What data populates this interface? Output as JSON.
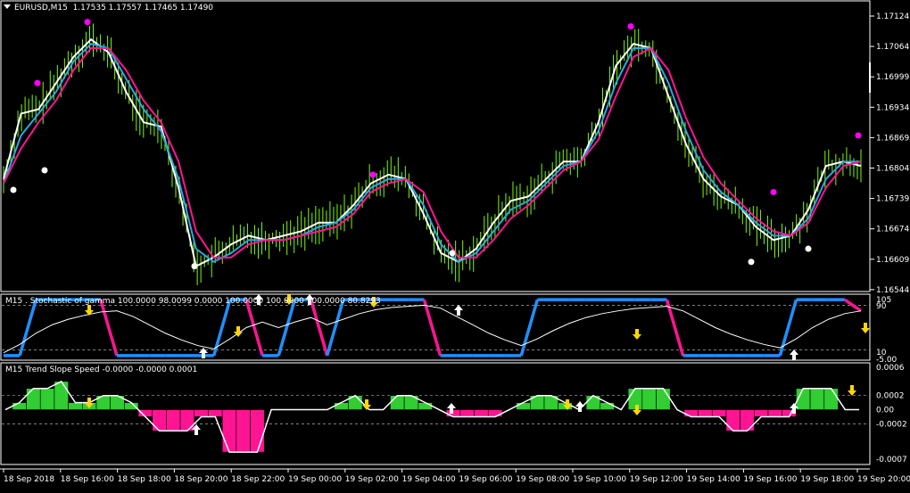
{
  "main_window": {
    "title": "EURUSD,M15",
    "ohlc": "1.17535 1.17557 1.17465 1.17490",
    "price_axis": [
      "1.17124",
      "1.17064",
      "1.16999",
      "1.16934",
      "1.16869",
      "1.16804",
      "1.16739",
      "1.16674",
      "1.16609",
      "1.16544"
    ]
  },
  "stoch_window": {
    "title": "M15 . Stochastic of gamma 100.0000 98.0099 0.0000 100.0000 100.0000 100.0000 80.8293",
    "axis": [
      "105",
      "90",
      "10",
      "-5.00"
    ]
  },
  "slope_window": {
    "title": "M15 Trend Slope Speed -0.0000 -0.0000 0.0001",
    "axis": [
      "0.0006",
      "0.0002",
      "0.00",
      "-0.0002",
      "-0.0007"
    ]
  },
  "time_axis": [
    "18 Sep 2018",
    "18 Sep 16:00",
    "18 Sep 18:00",
    "18 Sep 20:00",
    "18 Sep 22:00",
    "19 Sep 00:00",
    "19 Sep 02:00",
    "19 Sep 04:00",
    "19 Sep 06:00",
    "19 Sep 08:00",
    "19 Sep 10:00",
    "19 Sep 12:00",
    "19 Sep 14:00",
    "19 Sep 16:00",
    "19 Sep 18:00",
    "19 Sep 20:00"
  ],
  "colors": {
    "bars": "#7cfc00",
    "white_line": "#ffffff",
    "blue_line": "#29a8e0",
    "pink_line": "#ff1493",
    "dot_magenta": "#ff00ff",
    "dot_white": "#ffffff",
    "stoch_blue": "#1e90ff",
    "stoch_pink": "#ff1493",
    "hist_green": "#32cd32",
    "hist_pink": "#ff1493",
    "arrow_white": "#ffffff",
    "arrow_yellow": "#ffd700"
  },
  "chart_data": [
    {
      "type": "line",
      "title": "EURUSD,M15",
      "ylim": [
        1.16544,
        1.1719
      ],
      "series": [
        {
          "values": [
            1.168,
            1.1695,
            1.1696,
            1.1702,
            1.1708,
            1.1712,
            1.1709,
            1.17,
            1.1693,
            1.1692,
            1.1678,
            1.166,
            1.1662,
            1.1665,
            1.1667,
            1.1666,
            1.1667,
            1.1668,
            1.167,
            1.167,
            1.1674,
            1.1679,
            1.1681,
            1.168,
            1.1672,
            1.1663,
            1.1661,
            1.1664,
            1.167,
            1.1675,
            1.1676,
            1.168,
            1.1684,
            1.1684,
            1.1693,
            1.1706,
            1.1711,
            1.171,
            1.1699,
            1.1688,
            1.168,
            1.1676,
            1.1674,
            1.1669,
            1.1666,
            1.1667,
            1.1673,
            1.1683,
            1.1684,
            1.1683
          ]
        },
        {
          "values": [
            1.1679,
            1.169,
            1.1695,
            1.17,
            1.1707,
            1.1711,
            1.171,
            1.1703,
            1.1696,
            1.1691,
            1.168,
            1.1664,
            1.1661,
            1.1663,
            1.1666,
            1.1666,
            1.1666,
            1.1667,
            1.1669,
            1.167,
            1.1673,
            1.1678,
            1.168,
            1.168,
            1.1674,
            1.1665,
            1.1661,
            1.1663,
            1.1668,
            1.1673,
            1.1675,
            1.1679,
            1.1683,
            1.1684,
            1.1691,
            1.1702,
            1.171,
            1.171,
            1.1702,
            1.1691,
            1.1682,
            1.1677,
            1.1674,
            1.167,
            1.1667,
            1.1667,
            1.1671,
            1.168,
            1.1684,
            1.1684
          ]
        },
        {
          "values": [
            1.1679,
            1.1687,
            1.1693,
            1.1698,
            1.1705,
            1.171,
            1.171,
            1.1705,
            1.1698,
            1.1693,
            1.1684,
            1.1668,
            1.1662,
            1.1662,
            1.1665,
            1.1666,
            1.1666,
            1.1667,
            1.1668,
            1.1669,
            1.1672,
            1.1677,
            1.1679,
            1.168,
            1.1677,
            1.1668,
            1.1662,
            1.1662,
            1.1666,
            1.1671,
            1.1674,
            1.1678,
            1.1682,
            1.1684,
            1.1689,
            1.1699,
            1.1708,
            1.171,
            1.1705,
            1.1694,
            1.1685,
            1.1679,
            1.1675,
            1.1671,
            1.1668,
            1.1667,
            1.167,
            1.1678,
            1.1683,
            1.1684
          ]
        }
      ]
    },
    {
      "type": "line",
      "title": "M15 . Stochastic of gamma 100.0000 98.0099 0.0000 100.0000 100.0000 100.0000 80.8293",
      "ylim": [
        -5,
        105
      ],
      "series": [
        {
          "values": [
            0,
            0,
            100,
            100,
            100,
            100,
            100,
            0,
            0,
            0,
            0,
            0,
            0,
            0,
            100,
            100,
            0,
            0,
            100,
            100,
            0,
            100,
            100,
            100,
            100,
            100,
            100,
            0,
            0,
            0,
            0,
            0,
            0,
            100,
            100,
            100,
            100,
            100,
            100,
            100,
            100,
            100,
            0,
            0,
            0,
            0,
            0,
            0,
            0,
            100,
            100,
            100,
            100,
            80
          ]
        },
        {
          "values": [
            5,
            20,
            40,
            55,
            65,
            72,
            78,
            80,
            70,
            55,
            40,
            28,
            18,
            12,
            30,
            50,
            60,
            50,
            60,
            68,
            55,
            65,
            75,
            82,
            86,
            88,
            90,
            85,
            70,
            55,
            40,
            28,
            18,
            30,
            45,
            58,
            68,
            75,
            80,
            84,
            86,
            88,
            80,
            65,
            50,
            38,
            28,
            20,
            14,
            30,
            50,
            65,
            75,
            80
          ]
        }
      ]
    },
    {
      "type": "bar",
      "title": "M15 Trend Slope Speed -0.0000 -0.0000 0.0001",
      "ylim": [
        -0.0007,
        0.0006
      ],
      "values": [
        0.0,
        0.0001,
        0.0003,
        0.0003,
        0.0004,
        0.0001,
        0.0001,
        0.0002,
        0.0002,
        0.0001,
        -0.0001,
        -0.0003,
        -0.0003,
        -0.0003,
        -0.0001,
        -0.0001,
        -0.0006,
        -0.0006,
        -0.0006,
        0.0,
        0.0,
        0.0,
        0.0,
        0.0,
        0.0001,
        0.0002,
        0.0,
        0.0,
        0.0002,
        0.0002,
        0.0001,
        0.0,
        -0.0001,
        -0.0001,
        -0.0001,
        -0.0001,
        0.0,
        0.0001,
        0.0002,
        0.0002,
        0.0001,
        0.0,
        0.0002,
        0.0001,
        0.0,
        0.0003,
        0.0003,
        0.0003,
        0.0,
        -0.0001,
        -0.0001,
        -0.0001,
        -0.0003,
        -0.0003,
        -0.0001,
        -0.0001,
        -0.0001,
        0.0003,
        0.0003,
        0.0003,
        0.0,
        0.0
      ]
    }
  ]
}
